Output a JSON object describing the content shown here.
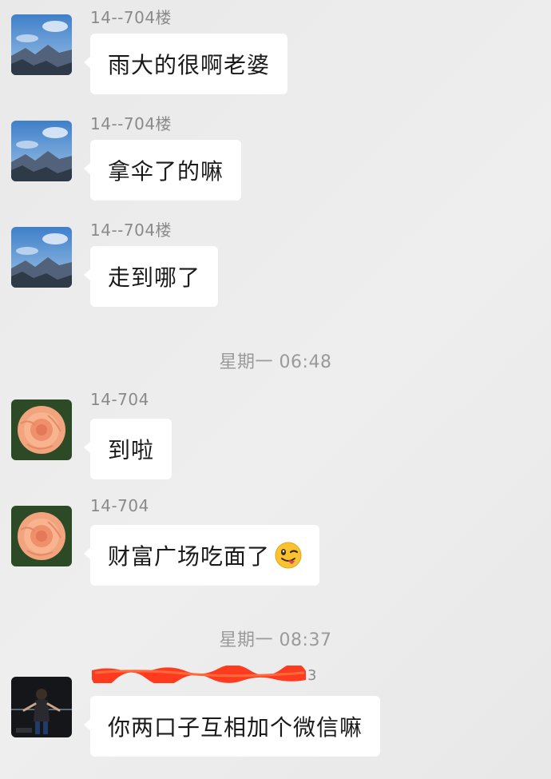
{
  "messages": [
    {
      "sender": "14--704楼",
      "text": "雨大的很啊老婆",
      "avatar": "mountain-landscape"
    },
    {
      "sender": "14--704楼",
      "text": "拿伞了的嘛",
      "avatar": "mountain-landscape"
    },
    {
      "sender": "14--704楼",
      "text": "走到哪了",
      "avatar": "mountain-landscape"
    },
    {
      "sender": "14-704",
      "text": "到啦",
      "avatar": "peach-rose"
    },
    {
      "sender": "14-704",
      "text": "财富广场吃面了",
      "emoji": "winking-tongue-emoji",
      "avatar": "peach-rose"
    },
    {
      "sender_suffix": "3",
      "text": "你两口子互相加个微信嘛",
      "avatar": "person-dark-photo"
    }
  ],
  "timestamps": [
    "星期一 06:48",
    "星期一 08:37"
  ],
  "colors": {
    "background": "#ececec",
    "bubble": "#ffffff",
    "sender_text": "#8a8a8a",
    "timestamp_text": "#9a9a9a",
    "redaction": "#ff3b1f"
  }
}
